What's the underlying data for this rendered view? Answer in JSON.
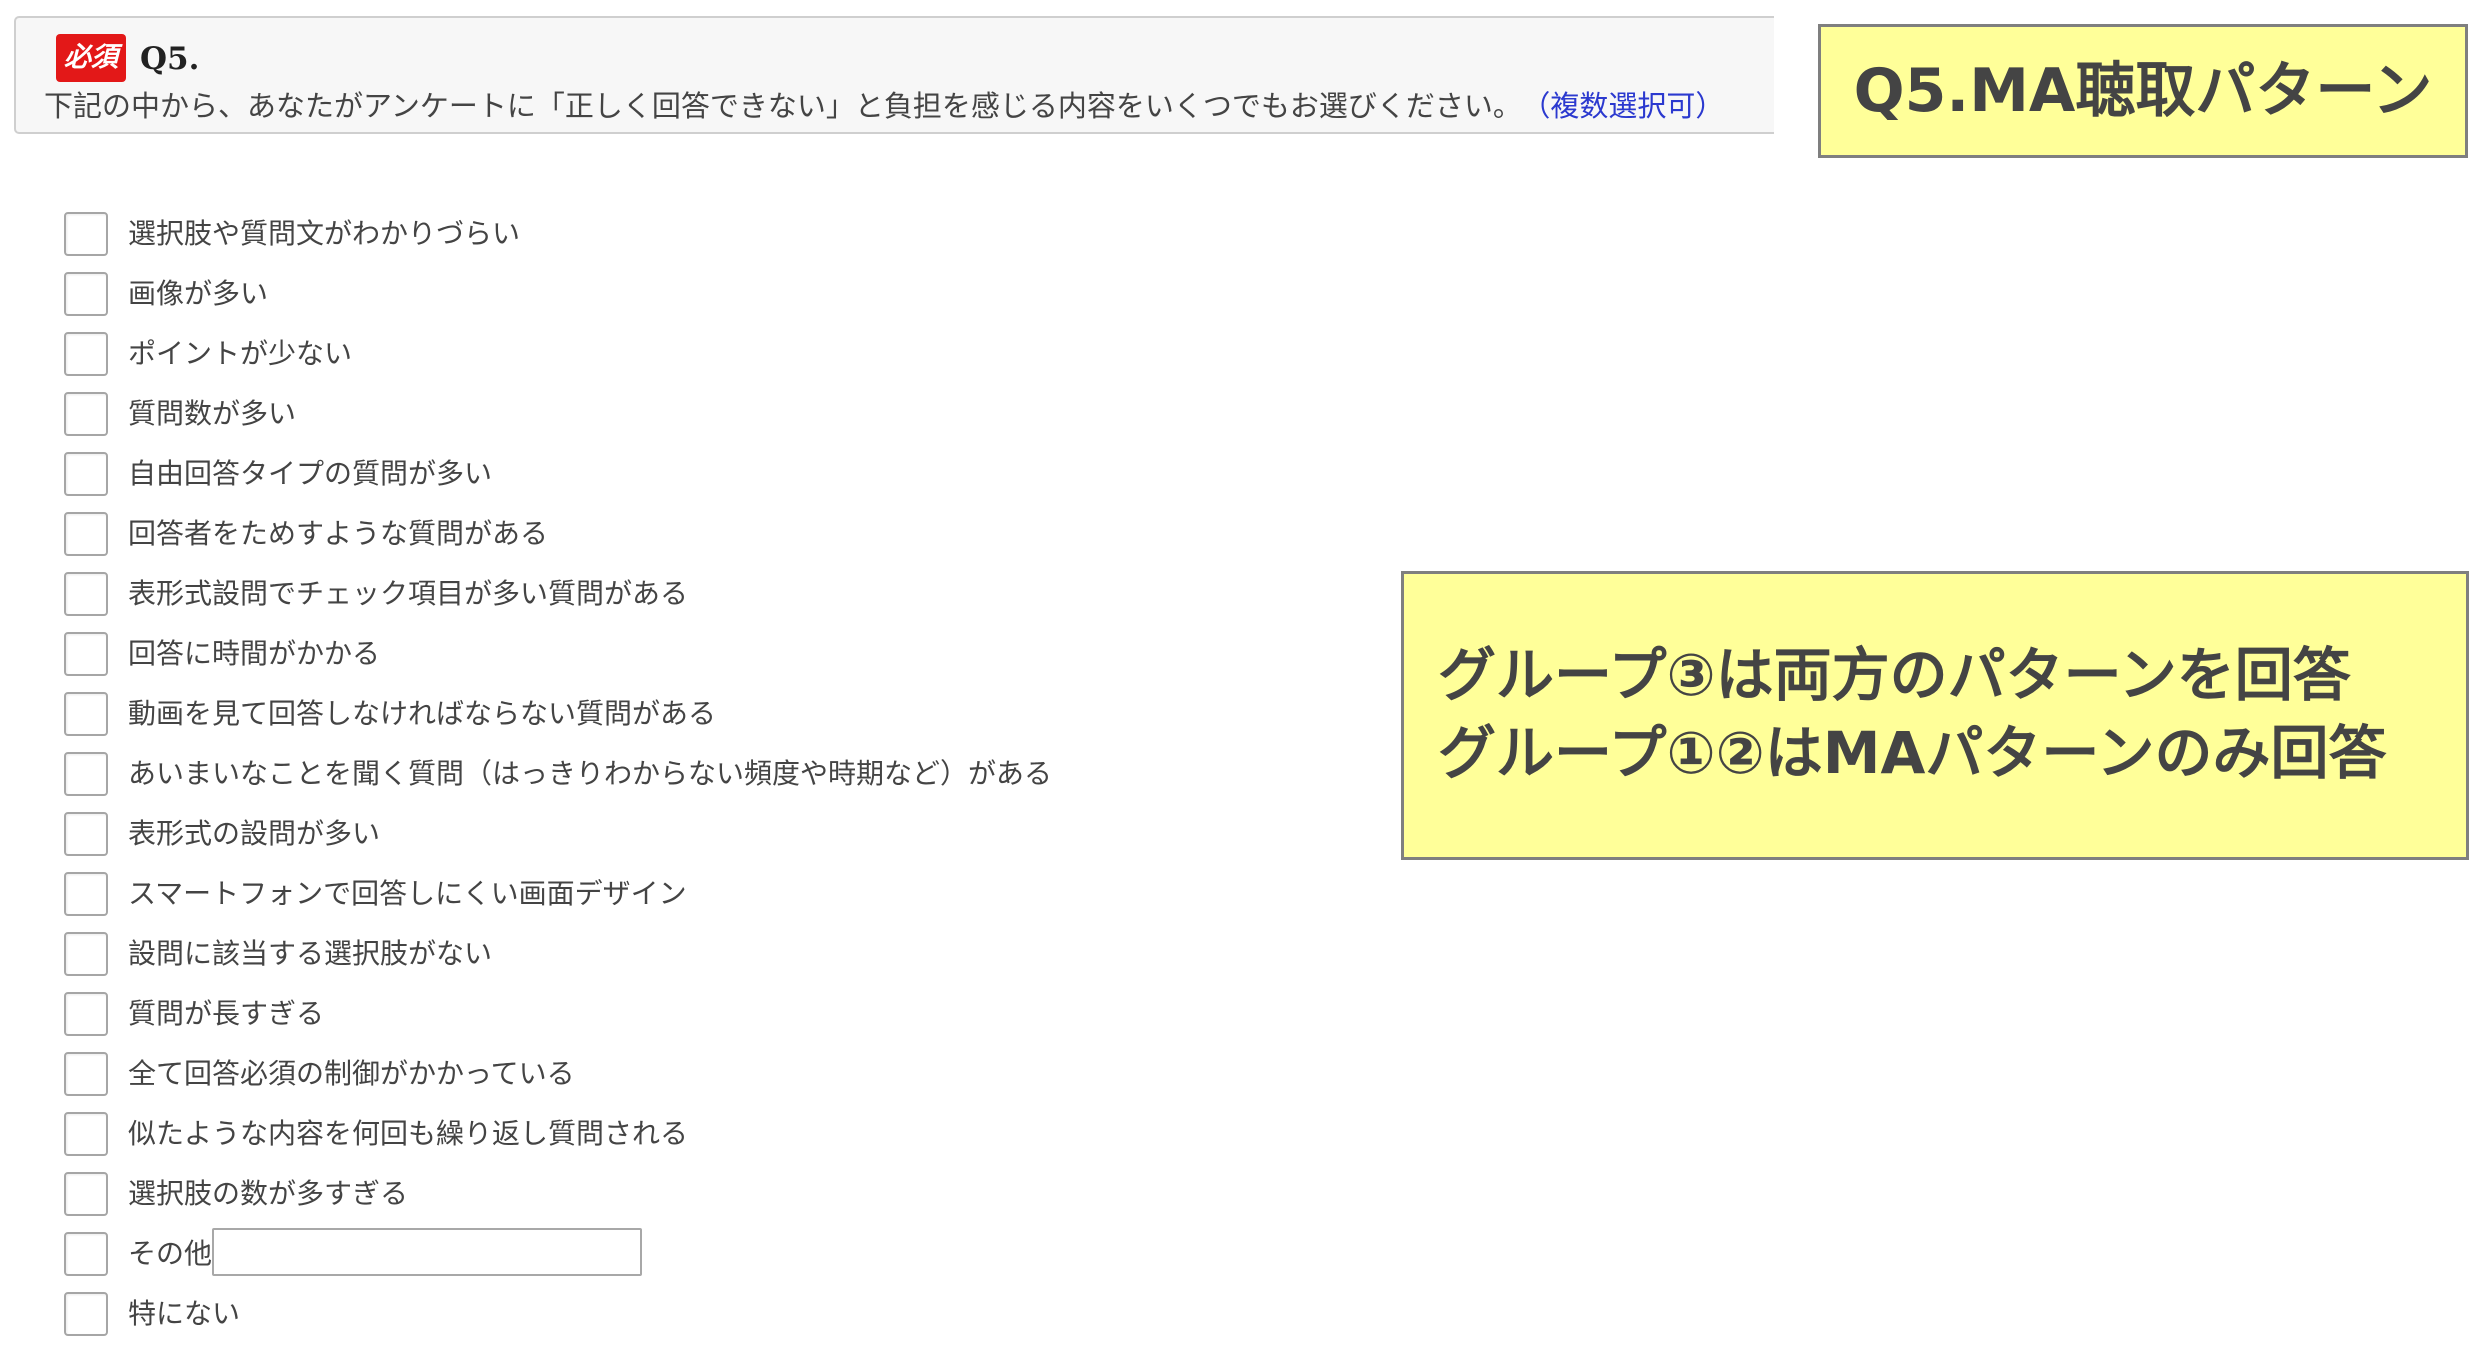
{
  "question": {
    "required_badge": "必須",
    "number": "Q5.",
    "text": "下記の中から、あなたがアンケートに「正しく回答できない」と負担を感じる内容をいくつでもお選びください。",
    "multi_note": "（複数選択可）"
  },
  "callouts": {
    "title": "Q5.MA聴取パターン",
    "note_line1": "グループ③は両方のパターンを回答",
    "note_line2": "グループ①②はMAパターンのみ回答"
  },
  "options": [
    {
      "label": "選択肢や質問文がわかりづらい",
      "checked": false
    },
    {
      "label": "画像が多い",
      "checked": false
    },
    {
      "label": "ポイントが少ない",
      "checked": false
    },
    {
      "label": "質問数が多い",
      "checked": false
    },
    {
      "label": "自由回答タイプの質問が多い",
      "checked": false
    },
    {
      "label": "回答者をためすような質問がある",
      "checked": false
    },
    {
      "label": "表形式設問でチェック項目が多い質問がある",
      "checked": false
    },
    {
      "label": "回答に時間がかかる",
      "checked": false
    },
    {
      "label": "動画を見て回答しなければならない質問がある",
      "checked": false
    },
    {
      "label": "あいまいなことを聞く質問（はっきりわからない頻度や時期など）がある",
      "checked": false
    },
    {
      "label": "表形式の設問が多い",
      "checked": false
    },
    {
      "label": "スマートフォンで回答しにくい画面デザイン",
      "checked": false
    },
    {
      "label": "設問に該当する選択肢がない",
      "checked": false
    },
    {
      "label": "質問が長すぎる",
      "checked": false
    },
    {
      "label": "全て回答必須の制御がかかっている",
      "checked": false
    },
    {
      "label": "似たような内容を何回も繰り返し質問される",
      "checked": false
    },
    {
      "label": "選択肢の数が多すぎる",
      "checked": false
    }
  ],
  "other_option": {
    "label": "その他",
    "value": "",
    "checked": false
  },
  "none_option": {
    "label": "特にない",
    "checked": false
  }
}
